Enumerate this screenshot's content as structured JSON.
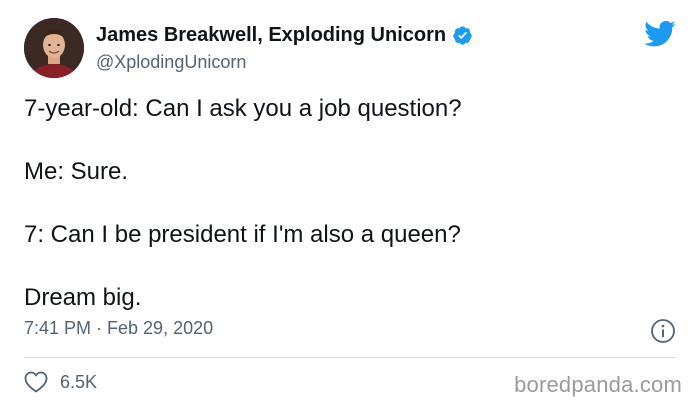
{
  "author": {
    "display_name": "James Breakwell, Exploding Unicorn",
    "handle": "@XplodingUnicorn",
    "verified": true
  },
  "tweet": {
    "lines": [
      "7-year-old: Can I ask you a job question?",
      "Me: Sure.",
      "7: Can I be president if I'm also a queen?",
      "Dream big."
    ],
    "timestamp": "7:41 PM · Feb 29, 2020",
    "likes": "6.5K"
  },
  "watermark": "boredpanda.com",
  "icons": {
    "brand": "twitter-bird-icon",
    "verified": "verified-badge-icon",
    "info": "info-icon",
    "like": "heart-icon"
  },
  "colors": {
    "twitter_blue": "#1d9bf0",
    "text": "#0f1419",
    "secondary_text": "#536471",
    "divider": "#cfd9de"
  }
}
